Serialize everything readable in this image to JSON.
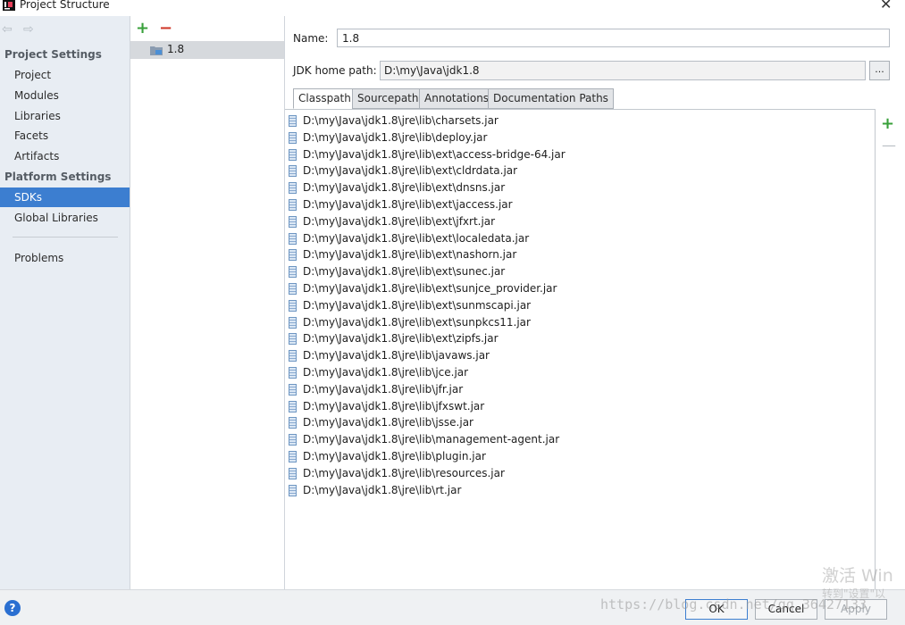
{
  "window": {
    "title": "Project Structure",
    "close_glyph": "✕"
  },
  "nav": {
    "back_glyph": "⇦",
    "forward_glyph": "⇨"
  },
  "sidebar": {
    "sections": [
      {
        "title": "Project Settings",
        "items": [
          "Project",
          "Modules",
          "Libraries",
          "Facets",
          "Artifacts"
        ]
      },
      {
        "title": "Platform Settings",
        "items": [
          "SDKs",
          "Global Libraries"
        ]
      }
    ],
    "problems": "Problems",
    "selected": "SDKs"
  },
  "sdk_list": {
    "add_glyph": "+",
    "remove_glyph": "−",
    "items": [
      "1.8"
    ]
  },
  "detail": {
    "name_label": "Name:",
    "name_value": "1.8",
    "home_label": "JDK home path:",
    "home_value": "D:\\my\\Java\\jdk1.8",
    "browse_label": "...",
    "tabs": [
      "Classpath",
      "Sourcepath",
      "Annotations",
      "Documentation Paths"
    ],
    "active_tab": "Classpath",
    "classpath": [
      "D:\\my\\Java\\jdk1.8\\jre\\lib\\charsets.jar",
      "D:\\my\\Java\\jdk1.8\\jre\\lib\\deploy.jar",
      "D:\\my\\Java\\jdk1.8\\jre\\lib\\ext\\access-bridge-64.jar",
      "D:\\my\\Java\\jdk1.8\\jre\\lib\\ext\\cldrdata.jar",
      "D:\\my\\Java\\jdk1.8\\jre\\lib\\ext\\dnsns.jar",
      "D:\\my\\Java\\jdk1.8\\jre\\lib\\ext\\jaccess.jar",
      "D:\\my\\Java\\jdk1.8\\jre\\lib\\ext\\jfxrt.jar",
      "D:\\my\\Java\\jdk1.8\\jre\\lib\\ext\\localedata.jar",
      "D:\\my\\Java\\jdk1.8\\jre\\lib\\ext\\nashorn.jar",
      "D:\\my\\Java\\jdk1.8\\jre\\lib\\ext\\sunec.jar",
      "D:\\my\\Java\\jdk1.8\\jre\\lib\\ext\\sunjce_provider.jar",
      "D:\\my\\Java\\jdk1.8\\jre\\lib\\ext\\sunmscapi.jar",
      "D:\\my\\Java\\jdk1.8\\jre\\lib\\ext\\sunpkcs11.jar",
      "D:\\my\\Java\\jdk1.8\\jre\\lib\\ext\\zipfs.jar",
      "D:\\my\\Java\\jdk1.8\\jre\\lib\\javaws.jar",
      "D:\\my\\Java\\jdk1.8\\jre\\lib\\jce.jar",
      "D:\\my\\Java\\jdk1.8\\jre\\lib\\jfr.jar",
      "D:\\my\\Java\\jdk1.8\\jre\\lib\\jfxswt.jar",
      "D:\\my\\Java\\jdk1.8\\jre\\lib\\jsse.jar",
      "D:\\my\\Java\\jdk1.8\\jre\\lib\\management-agent.jar",
      "D:\\my\\Java\\jdk1.8\\jre\\lib\\plugin.jar",
      "D:\\my\\Java\\jdk1.8\\jre\\lib\\resources.jar",
      "D:\\my\\Java\\jdk1.8\\jre\\lib\\rt.jar"
    ],
    "side_add_glyph": "+",
    "side_remove_glyph": "—"
  },
  "footer": {
    "help_label": "?",
    "ok_label": "OK",
    "cancel_label": "Cancel",
    "apply_label": "Apply"
  },
  "overlay": {
    "url_watermark": "https://blog.csdn.net/qq_36427133",
    "activate_windows": "激活 Win",
    "activate_hint": "转到\"设置\"以"
  },
  "colors": {
    "accent": "#3c7ed0",
    "sidebar_bg": "#e8edf3",
    "add_green": "#38a03a",
    "remove_red": "#d0392b"
  }
}
